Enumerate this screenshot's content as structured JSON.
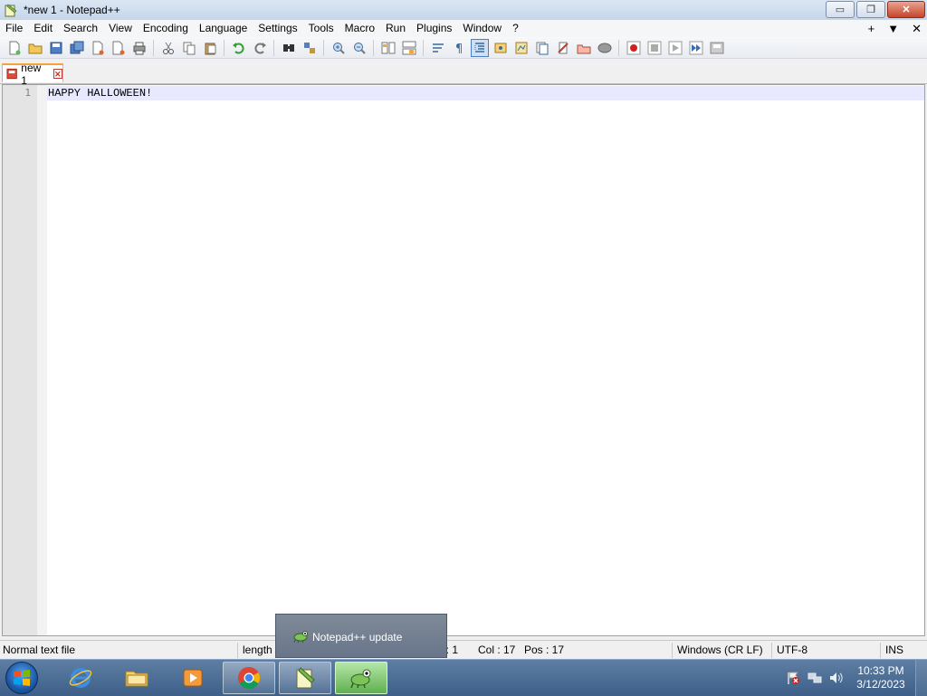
{
  "window": {
    "title": "*new 1 - Notepad++",
    "minimize_label": "▭",
    "maximize_label": "❐",
    "close_label": "✕"
  },
  "menu": {
    "items": [
      "File",
      "Edit",
      "Search",
      "View",
      "Encoding",
      "Language",
      "Settings",
      "Tools",
      "Macro",
      "Run",
      "Plugins",
      "Window",
      "?"
    ],
    "right": {
      "add": "+",
      "dropdown": "▼",
      "close": "✕"
    }
  },
  "tabs": [
    {
      "label": "new 1",
      "close": "✕"
    }
  ],
  "editor": {
    "lines": [
      {
        "number": "1",
        "text": "HAPPY HALLOWEEN!"
      }
    ]
  },
  "statusbar": {
    "type": "Normal text file",
    "length": "length",
    "line": "Ln : 1",
    "col": "Col : 17",
    "pos": "Pos : 17",
    "eol": "Windows (CR LF)",
    "encoding": "UTF-8",
    "mode": "INS"
  },
  "popup": {
    "text": "Notepad++ update"
  },
  "taskbar": {
    "time": "10:33 PM",
    "date": "3/12/2023"
  },
  "colors": {
    "tab_accent": "#f2a33a",
    "current_line": "#e8e8ff",
    "taskbar": "#4a6c94"
  }
}
